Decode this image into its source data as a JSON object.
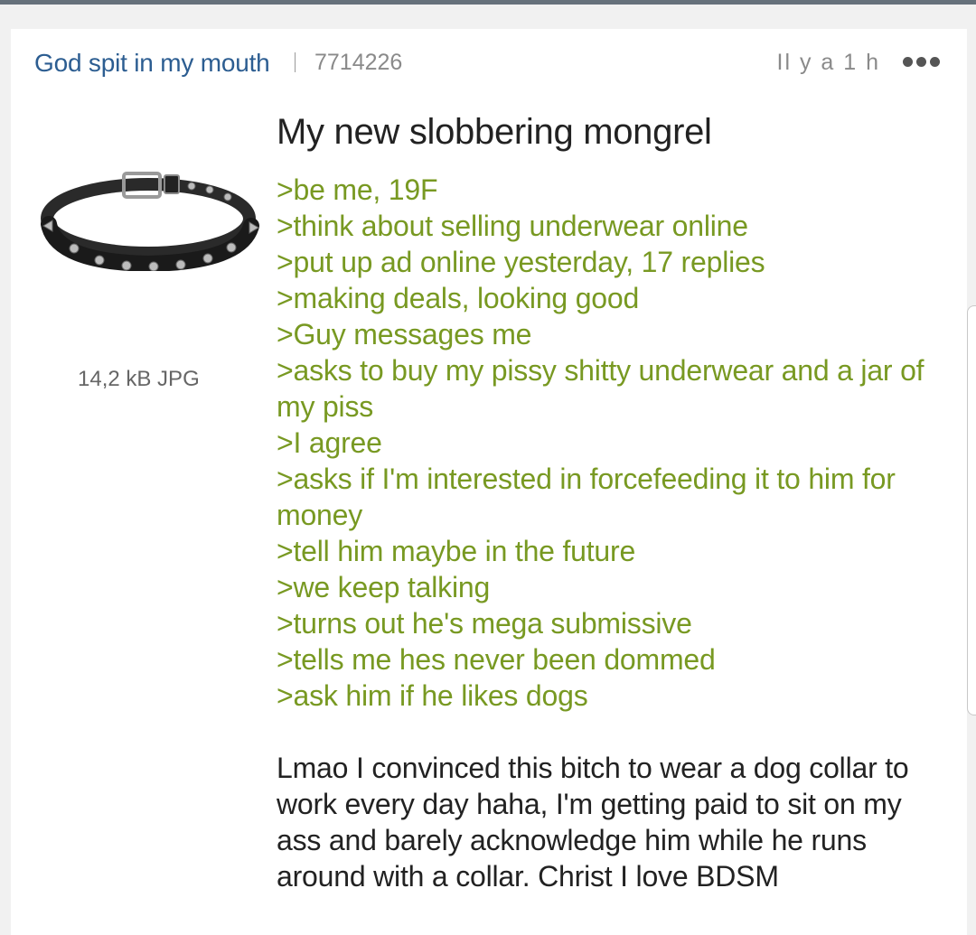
{
  "post": {
    "author": "God spit in my mouth",
    "id": "7714226",
    "time": "Il y a 1 h",
    "subject": "My new slobbering mongrel",
    "file_info": "14,2 kB JPG",
    "thumbnail": "dog-collar-image",
    "greentext": ">be me, 19F\n>think about selling underwear online\n>put up ad online yesterday, 17 replies\n>making deals, looking good\n>Guy messages me\n>asks to buy my pissy shitty underwear and a jar of my piss\n>I agree\n>asks if I'm interested in forcefeeding it to him for money\n>tell him maybe in the future\n>we keep talking\n>turns out he's mega submissive\n>tells me hes never been dommed\n>ask him if he likes dogs",
    "text": "Lmao I convinced this bitch to wear a dog collar to work every day haha, I'm getting paid to sit on my ass and barely acknowledge him while he runs around with a collar. Christ I love BDSM"
  },
  "colors": {
    "author": "#2c5d91",
    "greentext": "#789922",
    "meta": "#8a8a8a",
    "text": "#222222"
  },
  "icons": {
    "more": "more-options-icon"
  }
}
